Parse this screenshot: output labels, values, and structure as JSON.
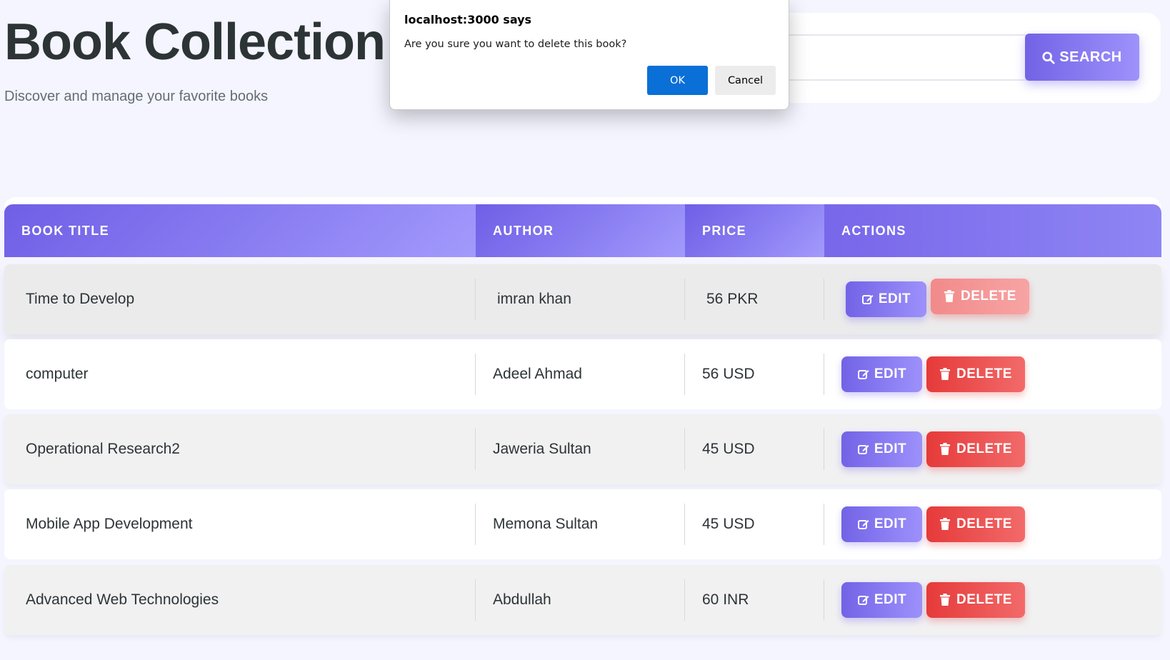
{
  "header": {
    "title": "Book Collection",
    "subtitle": "Discover and manage your favorite books"
  },
  "search": {
    "placeholder": "",
    "value": "",
    "button_label": "SEARCH",
    "button_icon": "search-icon"
  },
  "table": {
    "columns": [
      "BOOK TITLE",
      "AUTHOR",
      "PRICE",
      "ACTIONS"
    ],
    "rows": [
      {
        "title": "Time to Develop",
        "author": "imran khan",
        "price": "56 PKR"
      },
      {
        "title": "computer",
        "author": "Adeel Ahmad",
        "price": "56 USD"
      },
      {
        "title": "Operational Research2",
        "author": "Jaweria Sultan",
        "price": "45 USD"
      },
      {
        "title": "Mobile App Development",
        "author": "Memona Sultan",
        "price": "45 USD"
      },
      {
        "title": "Advanced Web Technologies",
        "author": "Abdullah",
        "price": "60 INR"
      }
    ],
    "edit_label": "EDIT",
    "delete_label": "DELETE"
  },
  "dialog": {
    "title": "localhost:3000 says",
    "message": "Are you sure you want to delete this book?",
    "ok_label": "OK",
    "cancel_label": "Cancel"
  },
  "colors": {
    "accent": "#6c5ce7",
    "danger": "#e63a3a",
    "dialog_ok": "#0a6fd6",
    "background": "#f5f5ff"
  }
}
